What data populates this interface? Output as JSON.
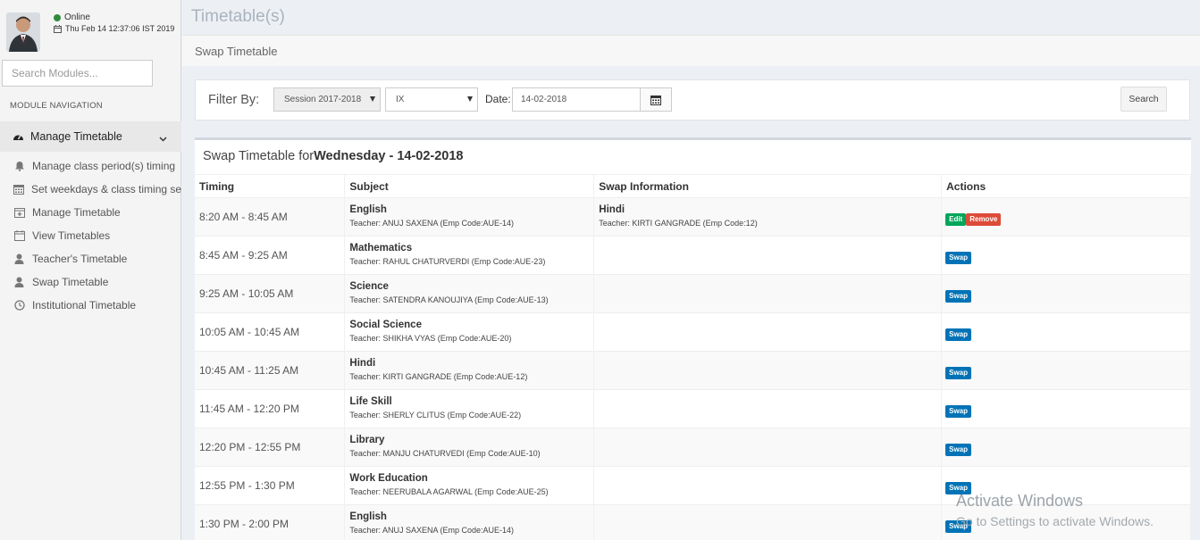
{
  "user": {
    "status": "Online",
    "datetime": "Thu Feb 14 12:37:06 IST 2019"
  },
  "sidebar": {
    "search_placeholder": "Search Modules...",
    "nav_header": "MODULE NAVIGATION",
    "active_group": {
      "label": "Manage Timetable",
      "icon": "dashboard-icon"
    },
    "items": [
      {
        "label": "Manage class period(s) timing",
        "icon": "bell-icon"
      },
      {
        "label": "Set weekdays & class timing sets",
        "icon": "calendar-icon"
      },
      {
        "label": "Manage Timetable",
        "icon": "calendar-plus-icon"
      },
      {
        "label": "View Timetables",
        "icon": "calendar-icon"
      },
      {
        "label": "Teacher's Timetable",
        "icon": "user-icon"
      },
      {
        "label": "Swap Timetable",
        "icon": "user-icon"
      },
      {
        "label": "Institutional Timetable",
        "icon": "clock-icon"
      }
    ]
  },
  "page": {
    "title": "Timetable(s)",
    "breadcrumb": "Swap Timetable"
  },
  "filter": {
    "label": "Filter By:",
    "session": "Session 2017-2018",
    "class": "IX",
    "date_label": "Date:",
    "date_value": "14-02-2018",
    "search_label": "Search"
  },
  "timetable": {
    "title_prefix": "Swap Timetable for",
    "title_day": "Wednesday - 14-02-2018",
    "headers": {
      "timing": "Timing",
      "subject": "Subject",
      "swap": "Swap Information",
      "actions": "Actions"
    },
    "rows": [
      {
        "timing": "8:20 AM - 8:45 AM",
        "subject": "English",
        "teacher": "Teacher: ANUJ SAXENA (Emp Code:AUE-14)",
        "swap_subject": "Hindi",
        "swap_teacher": "Teacher: KIRTI GANGRADE (Emp Code:12)",
        "edit": "Edit",
        "remove": "Remove"
      },
      {
        "timing": "8:45 AM - 9:25 AM",
        "subject": "Mathematics",
        "teacher": "Teacher: RAHUL CHATURVERDI (Emp Code:AUE-23)",
        "action": "Swap"
      },
      {
        "timing": "9:25 AM - 10:05 AM",
        "subject": "Science",
        "teacher": "Teacher: SATENDRA KANOUJIYA (Emp Code:AUE-13)",
        "action": "Swap"
      },
      {
        "timing": "10:05 AM - 10:45 AM",
        "subject": "Social Science",
        "teacher": "Teacher: SHIKHA VYAS (Emp Code:AUE-20)",
        "action": "Swap"
      },
      {
        "timing": "10:45 AM - 11:25 AM",
        "subject": "Hindi",
        "teacher": "Teacher: KIRTI GANGRADE (Emp Code:AUE-12)",
        "action": "Swap"
      },
      {
        "timing": "11:45 AM - 12:20 PM",
        "subject": "Life Skill",
        "teacher": "Teacher: SHERLY CLITUS (Emp Code:AUE-22)",
        "action": "Swap"
      },
      {
        "timing": "12:20 PM - 12:55 PM",
        "subject": "Library",
        "teacher": "Teacher: MANJU CHATURVEDI (Emp Code:AUE-10)",
        "action": "Swap"
      },
      {
        "timing": "12:55 PM - 1:30 PM",
        "subject": "Work Education",
        "teacher": "Teacher: NEERUBALA AGARWAL (Emp Code:AUE-25)",
        "action": "Swap"
      },
      {
        "timing": "1:30 PM - 2:00 PM",
        "subject": "English",
        "teacher": "Teacher: ANUJ SAXENA (Emp Code:AUE-14)",
        "action": "Swap"
      }
    ]
  },
  "watermark": {
    "line1": "Activate Windows",
    "line2": "Go to Settings to activate Windows."
  },
  "colors": {
    "swap": "#0073b7",
    "edit": "#00a65a",
    "remove": "#dd4b39",
    "online": "#2e8b3a"
  }
}
